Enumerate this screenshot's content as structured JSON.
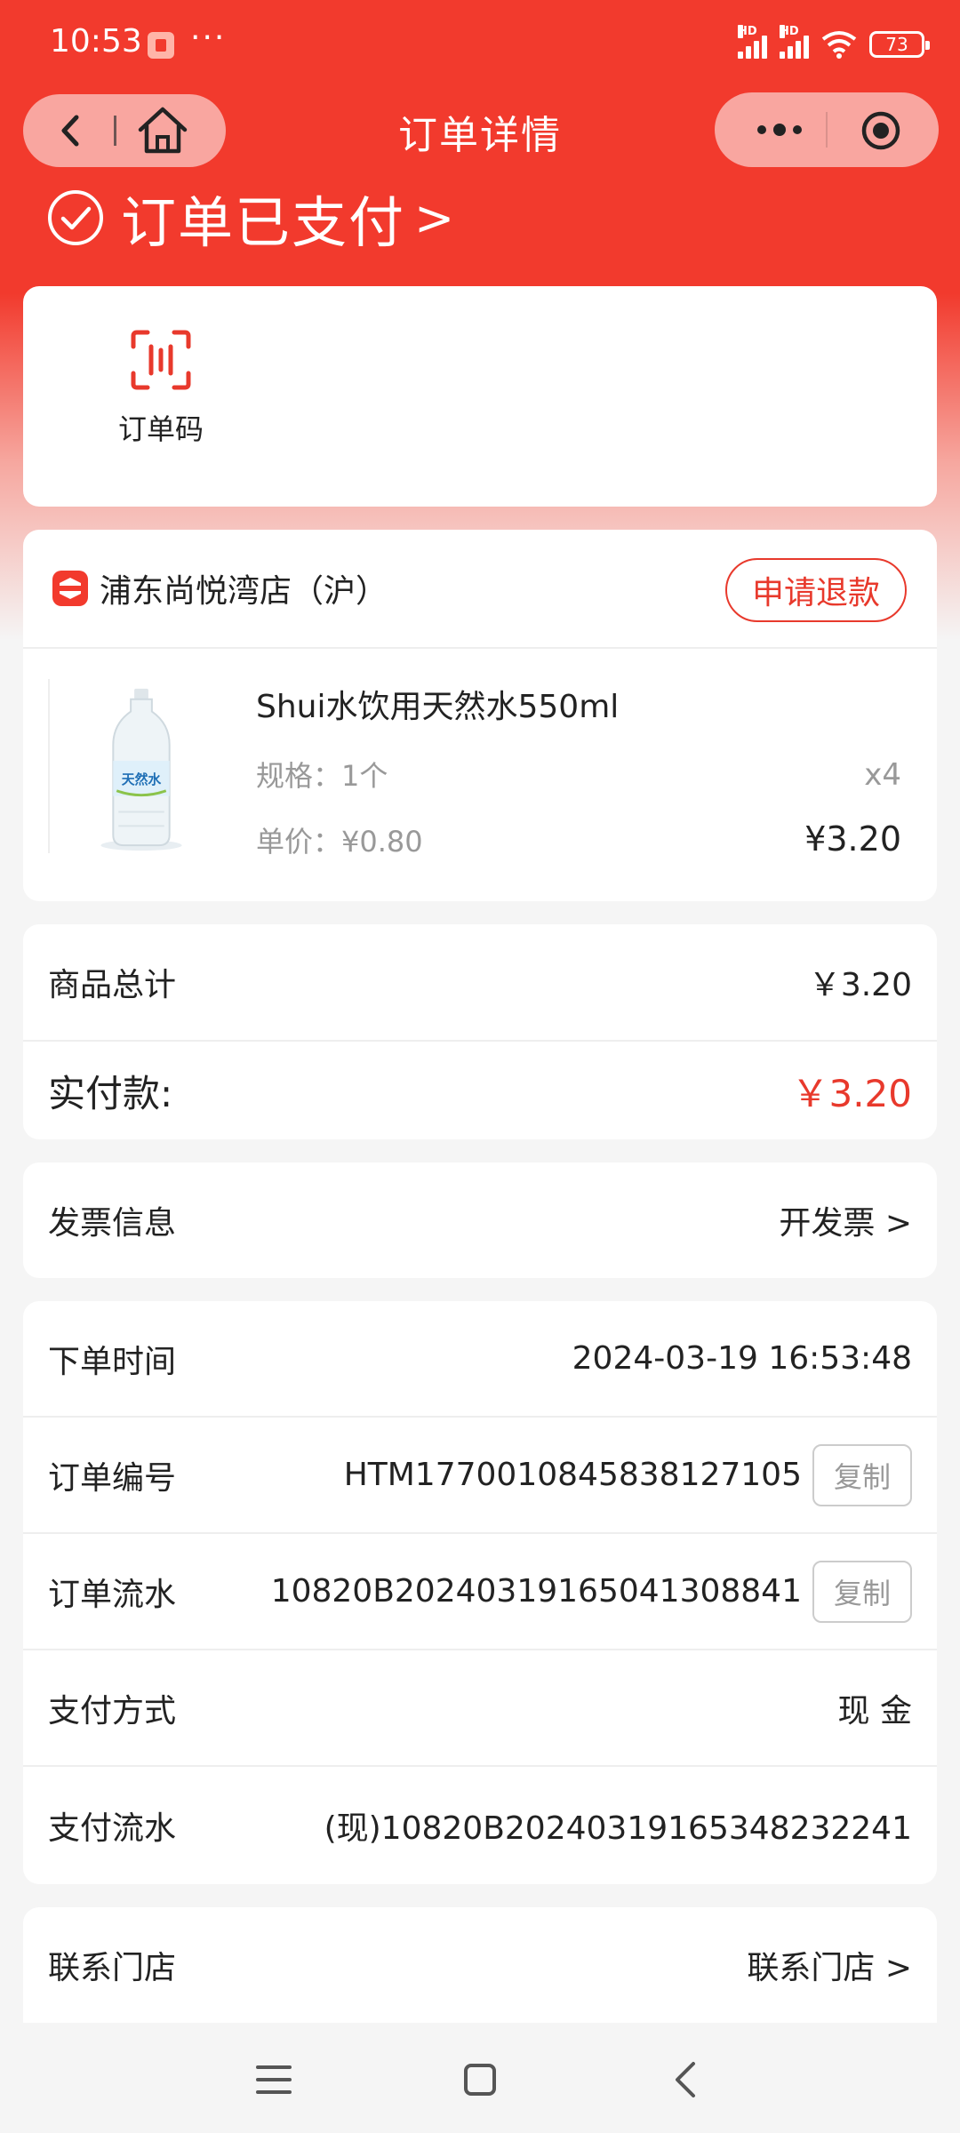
{
  "status_bar": {
    "time": "10:53",
    "more": "···",
    "battery": "73"
  },
  "nav": {
    "title": "订单详情"
  },
  "order_status": {
    "text": "订单已支付",
    "chevron": ">"
  },
  "quick_actions": [
    {
      "icon": "scan-code-icon",
      "label": "订单码"
    }
  ],
  "shop": {
    "name": "浦东尚悦湾店（沪）",
    "refund_label": "申请退款"
  },
  "product": {
    "name": "Shui水饮用天然水550ml",
    "spec": "规格：1个",
    "unit_price": "单价：¥0.80",
    "quantity": "x4",
    "subtotal": "¥3.20",
    "image_label": "天然水"
  },
  "totals": {
    "goods_label": "商品总计",
    "goods_value": "￥3.20",
    "paid_label": "实付款:",
    "paid_value": "￥3.20"
  },
  "invoice": {
    "label": "发票信息",
    "value": "开发票 >"
  },
  "details": {
    "order_time_label": "下单时间",
    "order_time": "2024-03-19 16:53:48",
    "order_no_label": "订单编号",
    "order_no": "HTM1770010845838127105",
    "serial_label": "订单流水",
    "serial": "10820B20240319165041308841",
    "copy_label": "复制",
    "pay_method_label": "支付方式",
    "pay_method": "现 金",
    "pay_serial_label": "支付流水",
    "pay_serial": "(现)10820B20240319165348232241"
  },
  "contact": {
    "label": "联系门店",
    "value": "联系门店 >"
  },
  "colors": {
    "primary": "#f23a2d",
    "accent_text": "#e8392c"
  }
}
